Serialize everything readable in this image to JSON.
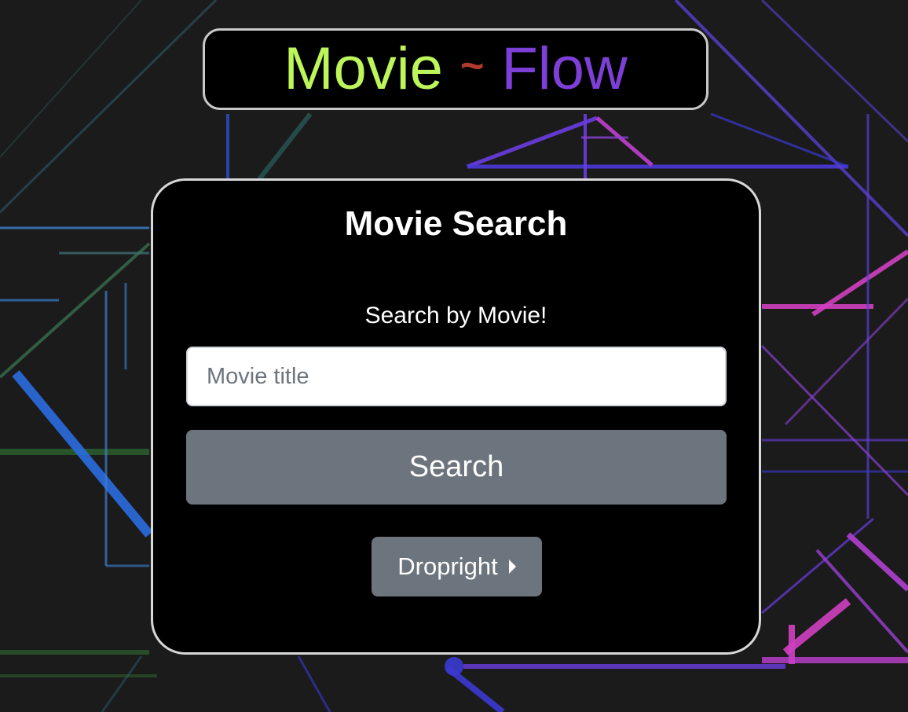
{
  "header": {
    "title_part1": "Movie",
    "title_separator": "~",
    "title_part2": "Flow",
    "colors": {
      "part1": "#bdf65a",
      "separator": "#b23a2a",
      "part2": "#7d3fd6"
    }
  },
  "card": {
    "heading": "Movie Search",
    "search_label": "Search by Movie!",
    "input": {
      "value": "",
      "placeholder": "Movie title"
    },
    "search_button_label": "Search",
    "dropdown_button_label": "Dropright",
    "dropdown_icon": "caret-right-icon"
  },
  "theme": {
    "button_gray": "#6c757d",
    "card_background": "#000000",
    "page_background": "#1b1b1c"
  }
}
